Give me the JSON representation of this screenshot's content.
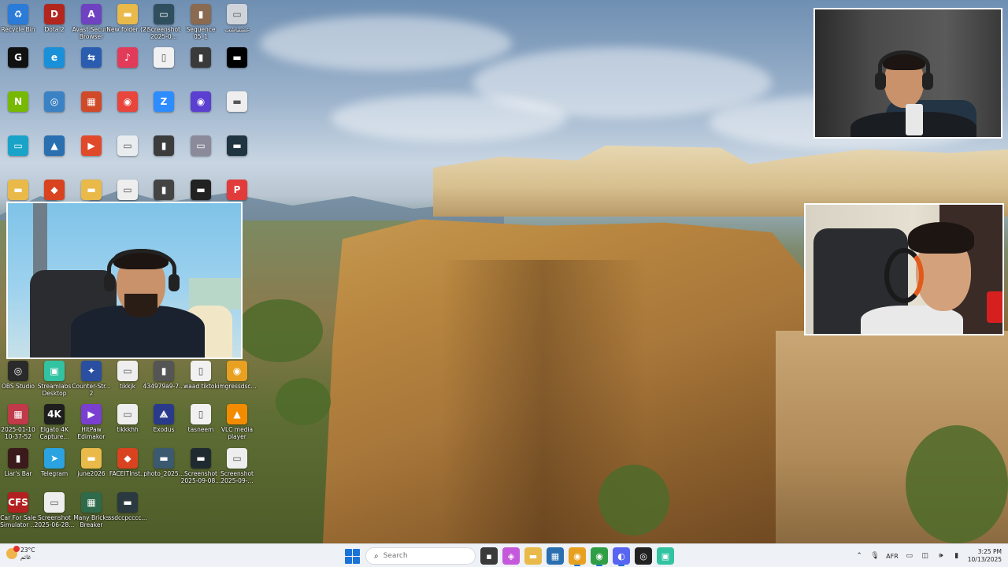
{
  "desktop": {
    "icons": [
      {
        "label": "Recycle Bin",
        "glyph": "♻",
        "color": "#2b7bd8"
      },
      {
        "label": "Dota 2",
        "glyph": "D",
        "color": "#b3261e"
      },
      {
        "label": "Avast Secure Browser",
        "glyph": "A",
        "color": "#6f42c1"
      },
      {
        "label": "New folder (2)",
        "glyph": "▬",
        "color": "#e9b949"
      },
      {
        "label": "Screenshot 2025-0...",
        "glyph": "▭",
        "color": "#2f4f5f"
      },
      {
        "label": "Sequence 05_1",
        "glyph": "▮",
        "color": "#8a6a50"
      },
      {
        "label": "عشتياشب",
        "glyph": "▭",
        "color": "#cfd4da"
      },
      {
        "label": "",
        "glyph": "G",
        "color": "#111111"
      },
      {
        "label": "",
        "glyph": "e",
        "color": "#1a90d9"
      },
      {
        "label": "",
        "glyph": "⇆",
        "color": "#2a5db0"
      },
      {
        "label": "",
        "glyph": "♪",
        "color": "#e23b5a"
      },
      {
        "label": "",
        "glyph": "▯",
        "color": "#f1f1f1"
      },
      {
        "label": "",
        "glyph": "▮",
        "color": "#3a3a3a"
      },
      {
        "label": "",
        "glyph": "▬",
        "color": "#000000"
      },
      {
        "label": "",
        "glyph": "N",
        "color": "#76b900"
      },
      {
        "label": "",
        "glyph": "◎",
        "color": "#3b82c4"
      },
      {
        "label": "",
        "glyph": "▦",
        "color": "#d04a2a"
      },
      {
        "label": "",
        "glyph": "◉",
        "color": "#e8453c"
      },
      {
        "label": "",
        "glyph": "Z",
        "color": "#2d8cff"
      },
      {
        "label": "",
        "glyph": "◉",
        "color": "#5a3fd0"
      },
      {
        "label": "",
        "glyph": "▬",
        "color": "#eeeeee"
      },
      {
        "label": "",
        "glyph": "▭",
        "color": "#1aa3c8"
      },
      {
        "label": "",
        "glyph": "▲",
        "color": "#2a6fb0"
      },
      {
        "label": "",
        "glyph": "▶",
        "color": "#e04a2a"
      },
      {
        "label": "",
        "glyph": "▭",
        "color": "#e9ecef"
      },
      {
        "label": "",
        "glyph": "▮",
        "color": "#3c3c3c"
      },
      {
        "label": "",
        "glyph": "▭",
        "color": "#8a8a9a"
      },
      {
        "label": "",
        "glyph": "▬",
        "color": "#1f3540"
      },
      {
        "label": "",
        "glyph": "▬",
        "color": "#e9b949"
      },
      {
        "label": "",
        "glyph": "◆",
        "color": "#d9431f"
      },
      {
        "label": "",
        "glyph": "▬",
        "color": "#e9b949"
      },
      {
        "label": "",
        "glyph": "▭",
        "color": "#eeeeee"
      },
      {
        "label": "",
        "glyph": "▮",
        "color": "#444444"
      },
      {
        "label": "",
        "glyph": "▬",
        "color": "#222222"
      },
      {
        "label": "",
        "glyph": "P",
        "color": "#e23b3b"
      },
      {
        "label": "OBS Studio",
        "glyph": "◎",
        "color": "#2a2a2a"
      },
      {
        "label": "Streamlabs Desktop",
        "glyph": "▣",
        "color": "#31c3a2"
      },
      {
        "label": "Counter-Str... 2",
        "glyph": "✦",
        "color": "#2a4fa0"
      },
      {
        "label": "tikkjk",
        "glyph": "▭",
        "color": "#eeeeee"
      },
      {
        "label": "434979a9-7...",
        "glyph": "▮",
        "color": "#555555"
      },
      {
        "label": "waad tiktok",
        "glyph": "▯",
        "color": "#f1f1f1"
      },
      {
        "label": "imgressdsc...",
        "glyph": "◉",
        "color": "#e8a020"
      },
      {
        "label": "2025-01-10 10-37-52",
        "glyph": "▦",
        "color": "#c03a4a"
      },
      {
        "label": "Elgato 4K Capture...",
        "glyph": "4K",
        "color": "#1e1e1e"
      },
      {
        "label": "HitPaw Edimakor",
        "glyph": "▶",
        "color": "#7a3fd0"
      },
      {
        "label": "tikkkhh",
        "glyph": "▭",
        "color": "#eeeeee"
      },
      {
        "label": "Exodus",
        "glyph": "⟁",
        "color": "#2a3a8a"
      },
      {
        "label": "tasneem",
        "glyph": "▯",
        "color": "#f1f1f1"
      },
      {
        "label": "VLC media player",
        "glyph": "▲",
        "color": "#f28b00"
      },
      {
        "label": "Liar's Bar",
        "glyph": "▮",
        "color": "#3a1a1a"
      },
      {
        "label": "Telegram",
        "glyph": "➤",
        "color": "#2aa3e0"
      },
      {
        "label": "june2026",
        "glyph": "▬",
        "color": "#e9b949"
      },
      {
        "label": "FACEITInst...",
        "glyph": "◆",
        "color": "#d9431f"
      },
      {
        "label": "photo_2025...",
        "glyph": "▬",
        "color": "#3b5a70"
      },
      {
        "label": "Screenshot 2025-09-08...",
        "glyph": "▬",
        "color": "#1f2a30"
      },
      {
        "label": "Screenshot 2025-09-...",
        "glyph": "▭",
        "color": "#eeeeee"
      },
      {
        "label": "Car For Sale Simulator ...",
        "glyph": "CFS",
        "color": "#b32020"
      },
      {
        "label": "Screenshot 2025-06-28...",
        "glyph": "▭",
        "color": "#eeeeee"
      },
      {
        "label": "Many Bricks Breaker",
        "glyph": "▦",
        "color": "#2f6a4a"
      },
      {
        "label": "ssdccpcccc...",
        "glyph": "▬",
        "color": "#2a3a40"
      }
    ]
  },
  "taskbar": {
    "weather_temp": "23°C",
    "weather_desc": "غائم",
    "search_placeholder": "Search",
    "apps": [
      {
        "name": "file-explorer-tab",
        "glyph": "▪",
        "color": "#3a3a3a"
      },
      {
        "name": "copilot",
        "glyph": "◈",
        "color": "#c45adb"
      },
      {
        "name": "file-explorer",
        "glyph": "▬",
        "color": "#e9b949"
      },
      {
        "name": "microsoft-store",
        "glyph": "▦",
        "color": "#2a6fb0"
      },
      {
        "name": "chrome-canary",
        "glyph": "◉",
        "color": "#e8a020"
      },
      {
        "name": "chrome",
        "glyph": "◉",
        "color": "#2f9e44"
      },
      {
        "name": "discord",
        "glyph": "◐",
        "color": "#5865f2"
      },
      {
        "name": "obs",
        "glyph": "◎",
        "color": "#222222"
      },
      {
        "name": "streamlabs",
        "glyph": "▣",
        "color": "#31c3a2"
      }
    ],
    "tray": {
      "language": "AFR",
      "time": "3:25 PM",
      "date": "10/13/2025"
    }
  }
}
